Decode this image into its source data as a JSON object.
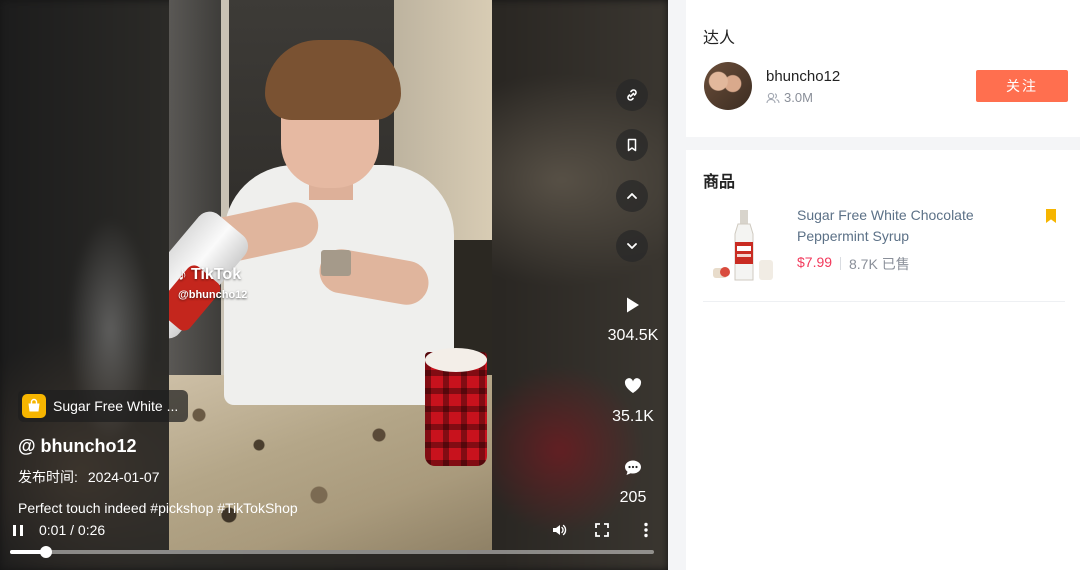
{
  "video": {
    "watermark_brand": "TikTok",
    "watermark_handle": "@bhuncho12",
    "product_chip": "Sugar Free White ...",
    "author": "@ bhuncho12",
    "publish_label": "发布时间:",
    "publish_date": "2024-01-07",
    "description": "Perfect touch indeed #pickshop #TikTokShop",
    "current_time": "0:01",
    "time_sep": "/",
    "duration": "0:26",
    "progress_fraction": 0.056,
    "stats": {
      "plays": "304.5K",
      "likes": "35.1K",
      "comments": "205"
    },
    "side_icons": [
      "link-icon",
      "bookmark-icon",
      "chevron-up-icon",
      "chevron-down-icon"
    ],
    "control_icons": [
      "pause-icon",
      "volume-icon",
      "fullscreen-icon",
      "more-icon"
    ]
  },
  "creator": {
    "section_title": "达人",
    "name": "bhuncho12",
    "followers": "3.0M",
    "follow_label": "关注"
  },
  "products": {
    "section_title": "商品",
    "items": [
      {
        "title": "Sugar Free White Chocolate Peppermint Syrup",
        "price": "$7.99",
        "sold": "8.7K 已售"
      }
    ]
  },
  "colors": {
    "accent": "#ff6f4f",
    "price": "#f23a5c",
    "bookmark": "#f6b500",
    "chip_icon": "#f6b500"
  }
}
